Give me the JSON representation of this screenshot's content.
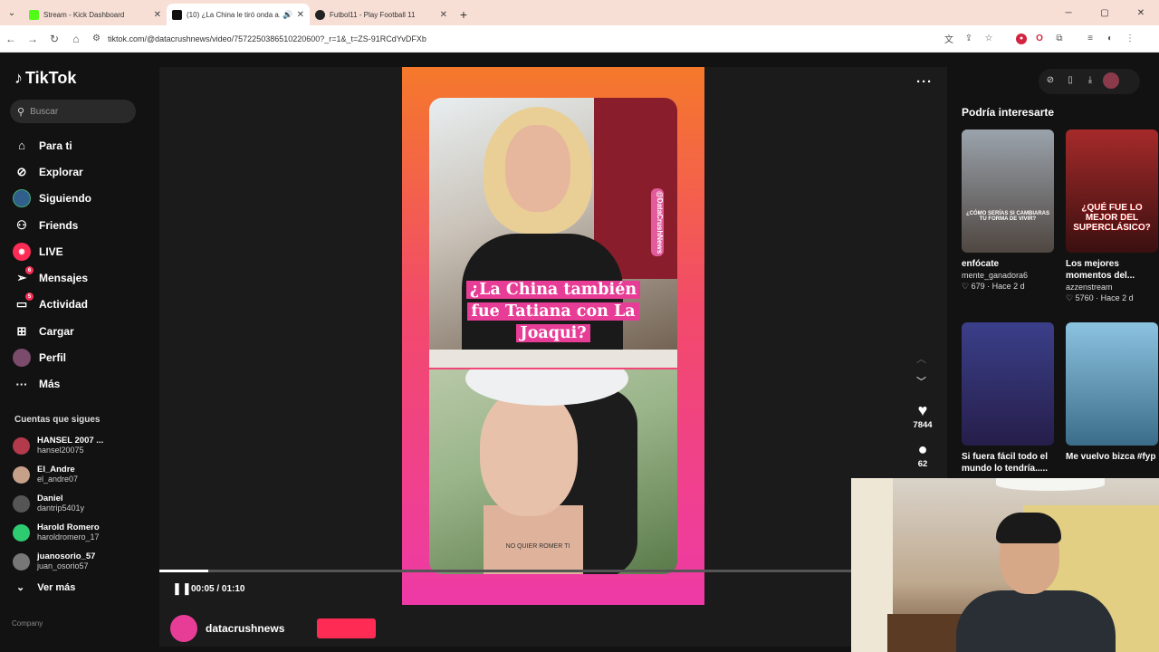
{
  "browser": {
    "tabs": [
      {
        "title": "Stream - Kick Dashboard",
        "favicon_color": "#53fc18",
        "active": false
      },
      {
        "title": "(10) ¿La China le tiró onda a...",
        "favicon_color": "#111111",
        "active": true
      },
      {
        "title": "Futbol11 - Play Football 11",
        "favicon_color": "#222222",
        "active": false
      }
    ],
    "url": "tiktok.com/@datacrushnews/video/7572250386510220600?_r=1&_t=ZS-91RCdYvDFXb"
  },
  "sidebar": {
    "logo": "TikTok",
    "search_placeholder": "Buscar",
    "nav": [
      {
        "label": "Para ti",
        "icon": "home-icon",
        "glyph": "⌂"
      },
      {
        "label": "Explorar",
        "icon": "compass-icon",
        "glyph": "⊘"
      },
      {
        "label": "Siguiendo",
        "icon": "following-avatar-icon",
        "glyph": ""
      },
      {
        "label": "Friends",
        "icon": "friends-icon",
        "glyph": "⚇"
      },
      {
        "label": "LIVE",
        "icon": "live-icon",
        "glyph": "◉"
      },
      {
        "label": "Mensajes",
        "icon": "messages-icon",
        "glyph": "➢",
        "badge": "6"
      },
      {
        "label": "Actividad",
        "icon": "activity-icon",
        "glyph": "▭",
        "badge": "5"
      },
      {
        "label": "Cargar",
        "icon": "upload-icon",
        "glyph": "⊞"
      },
      {
        "label": "Perfil",
        "icon": "profile-icon",
        "glyph": ""
      },
      {
        "label": "Más",
        "icon": "more-dots-icon",
        "glyph": "···"
      }
    ],
    "following_title": "Cuentas que sigues",
    "following": [
      {
        "name": "HANSEL 2007 ...",
        "handle": "hansel20075",
        "color": "#b23a4a"
      },
      {
        "name": "El_Andre",
        "handle": "el_andre07",
        "color": "#c7a08a"
      },
      {
        "name": "Daniel",
        "handle": "dantrip5401y",
        "color": "#555555"
      },
      {
        "name": "Harold Romero",
        "handle": "haroldromero_17",
        "color": "#2ecc71"
      },
      {
        "name": "juanosorio_57",
        "handle": "juan_osorio57",
        "color": "#777777"
      }
    ],
    "see_more": "Ver más",
    "company": "Company"
  },
  "video": {
    "caption": "¿La China también fue Tatiana con La Joaqui?",
    "watermark": "@DataCrushNews",
    "tattoo": "NO QUIER ROMER TI",
    "time": "00:05 / 01:10",
    "progress": 0.07,
    "likes": "7844",
    "comments": "62",
    "author": "datacrushnews"
  },
  "recommendations": {
    "title": "Podría interesarte",
    "items": [
      {
        "title": "enfócate",
        "author": "mente_ganadora6",
        "likes": "679",
        "ago": "Hace 2 d",
        "thumb_text": "¿CÓMO SERÍAS SI CAMBIARAS TU FORMA DE VIVIR?",
        "bg": "#5c6670"
      },
      {
        "title": "Los mejores momentos del...",
        "author": "azzenstream",
        "likes": "5760",
        "ago": "Hace 2 d",
        "thumb_text": "¿QUÉ FUE LO MEJOR DEL SUPERCLÁSICO?",
        "bg": "#7a1e1e"
      },
      {
        "title": "Si fuera fácil todo el mundo lo tendría.....",
        "author": "",
        "likes": "",
        "ago": "",
        "thumb_text": "",
        "bg": "#2d2a6e"
      },
      {
        "title": "Me vuelvo bizca #fyp",
        "author": "",
        "likes": "",
        "ago": "",
        "thumb_text": "",
        "bg": "#6aa7c8"
      }
    ]
  }
}
